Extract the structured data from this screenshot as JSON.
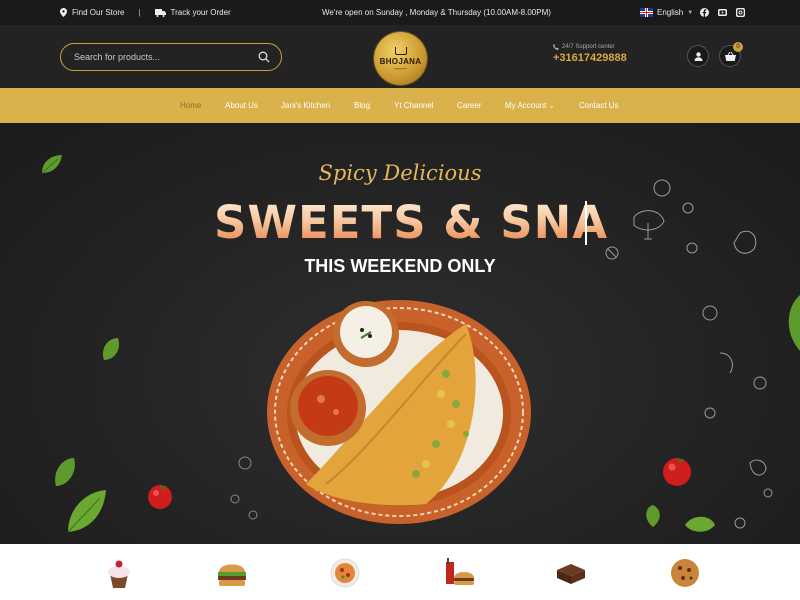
{
  "topbar": {
    "find_store": "Find Our Store",
    "separator": "|",
    "track_order": "Track your Order",
    "hours": "We're open on Sunday , Monday & Thursday (10.00AM-8.00PM)",
    "language": "English",
    "social_icons": [
      "facebook-icon",
      "youtube-icon",
      "instagram-icon"
    ]
  },
  "header": {
    "search_placeholder": "Search for products...",
    "logo_name": "BHOJANA",
    "support_label": "24/7 Support center",
    "support_phone": "+31617429888",
    "cart_count": "0"
  },
  "nav": {
    "items": [
      "Home",
      "About Us",
      "Jani's Kitchen",
      "Blog",
      "Yt Channel",
      "Career",
      "My Account",
      "Contact Us"
    ],
    "active": "Home"
  },
  "hero": {
    "script": "Spicy Delicious",
    "title": "SWEETS & SNA",
    "subtitle": "THIS WEEKEND ONLY"
  },
  "categories": [
    "cupcake-icon",
    "burger-icon",
    "pizza-icon",
    "fastfood-combo-icon",
    "brownie-icon",
    "cookie-icon"
  ],
  "colors": {
    "gold": "#c9a03e",
    "nav_bg": "#dab24c",
    "dark": "#232323"
  }
}
